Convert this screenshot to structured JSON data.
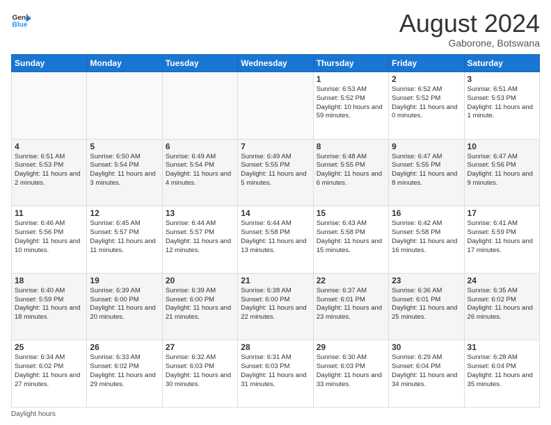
{
  "header": {
    "logo_line1": "General",
    "logo_line2": "Blue",
    "month_year": "August 2024",
    "location": "Gaborone, Botswana"
  },
  "days_of_week": [
    "Sunday",
    "Monday",
    "Tuesday",
    "Wednesday",
    "Thursday",
    "Friday",
    "Saturday"
  ],
  "weeks": [
    [
      {
        "day": "",
        "info": ""
      },
      {
        "day": "",
        "info": ""
      },
      {
        "day": "",
        "info": ""
      },
      {
        "day": "",
        "info": ""
      },
      {
        "day": "1",
        "info": "Sunrise: 6:53 AM\nSunset: 5:52 PM\nDaylight: 10 hours and 59 minutes."
      },
      {
        "day": "2",
        "info": "Sunrise: 6:52 AM\nSunset: 5:52 PM\nDaylight: 11 hours and 0 minutes."
      },
      {
        "day": "3",
        "info": "Sunrise: 6:51 AM\nSunset: 5:53 PM\nDaylight: 11 hours and 1 minute."
      }
    ],
    [
      {
        "day": "4",
        "info": "Sunrise: 6:51 AM\nSunset: 5:53 PM\nDaylight: 11 hours and 2 minutes."
      },
      {
        "day": "5",
        "info": "Sunrise: 6:50 AM\nSunset: 5:54 PM\nDaylight: 11 hours and 3 minutes."
      },
      {
        "day": "6",
        "info": "Sunrise: 6:49 AM\nSunset: 5:54 PM\nDaylight: 11 hours and 4 minutes."
      },
      {
        "day": "7",
        "info": "Sunrise: 6:49 AM\nSunset: 5:55 PM\nDaylight: 11 hours and 5 minutes."
      },
      {
        "day": "8",
        "info": "Sunrise: 6:48 AM\nSunset: 5:55 PM\nDaylight: 11 hours and 6 minutes."
      },
      {
        "day": "9",
        "info": "Sunrise: 6:47 AM\nSunset: 5:55 PM\nDaylight: 11 hours and 8 minutes."
      },
      {
        "day": "10",
        "info": "Sunrise: 6:47 AM\nSunset: 5:56 PM\nDaylight: 11 hours and 9 minutes."
      }
    ],
    [
      {
        "day": "11",
        "info": "Sunrise: 6:46 AM\nSunset: 5:56 PM\nDaylight: 11 hours and 10 minutes."
      },
      {
        "day": "12",
        "info": "Sunrise: 6:45 AM\nSunset: 5:57 PM\nDaylight: 11 hours and 11 minutes."
      },
      {
        "day": "13",
        "info": "Sunrise: 6:44 AM\nSunset: 5:57 PM\nDaylight: 11 hours and 12 minutes."
      },
      {
        "day": "14",
        "info": "Sunrise: 6:44 AM\nSunset: 5:58 PM\nDaylight: 11 hours and 13 minutes."
      },
      {
        "day": "15",
        "info": "Sunrise: 6:43 AM\nSunset: 5:58 PM\nDaylight: 11 hours and 15 minutes."
      },
      {
        "day": "16",
        "info": "Sunrise: 6:42 AM\nSunset: 5:58 PM\nDaylight: 11 hours and 16 minutes."
      },
      {
        "day": "17",
        "info": "Sunrise: 6:41 AM\nSunset: 5:59 PM\nDaylight: 11 hours and 17 minutes."
      }
    ],
    [
      {
        "day": "18",
        "info": "Sunrise: 6:40 AM\nSunset: 5:59 PM\nDaylight: 11 hours and 18 minutes."
      },
      {
        "day": "19",
        "info": "Sunrise: 6:39 AM\nSunset: 6:00 PM\nDaylight: 11 hours and 20 minutes."
      },
      {
        "day": "20",
        "info": "Sunrise: 6:39 AM\nSunset: 6:00 PM\nDaylight: 11 hours and 21 minutes."
      },
      {
        "day": "21",
        "info": "Sunrise: 6:38 AM\nSunset: 6:00 PM\nDaylight: 11 hours and 22 minutes."
      },
      {
        "day": "22",
        "info": "Sunrise: 6:37 AM\nSunset: 6:01 PM\nDaylight: 11 hours and 23 minutes."
      },
      {
        "day": "23",
        "info": "Sunrise: 6:36 AM\nSunset: 6:01 PM\nDaylight: 11 hours and 25 minutes."
      },
      {
        "day": "24",
        "info": "Sunrise: 6:35 AM\nSunset: 6:02 PM\nDaylight: 11 hours and 26 minutes."
      }
    ],
    [
      {
        "day": "25",
        "info": "Sunrise: 6:34 AM\nSunset: 6:02 PM\nDaylight: 11 hours and 27 minutes."
      },
      {
        "day": "26",
        "info": "Sunrise: 6:33 AM\nSunset: 6:02 PM\nDaylight: 11 hours and 29 minutes."
      },
      {
        "day": "27",
        "info": "Sunrise: 6:32 AM\nSunset: 6:03 PM\nDaylight: 11 hours and 30 minutes."
      },
      {
        "day": "28",
        "info": "Sunrise: 6:31 AM\nSunset: 6:03 PM\nDaylight: 11 hours and 31 minutes."
      },
      {
        "day": "29",
        "info": "Sunrise: 6:30 AM\nSunset: 6:03 PM\nDaylight: 11 hours and 33 minutes."
      },
      {
        "day": "30",
        "info": "Sunrise: 6:29 AM\nSunset: 6:04 PM\nDaylight: 11 hours and 34 minutes."
      },
      {
        "day": "31",
        "info": "Sunrise: 6:28 AM\nSunset: 6:04 PM\nDaylight: 11 hours and 35 minutes."
      }
    ]
  ],
  "footer": {
    "note": "Daylight hours"
  }
}
